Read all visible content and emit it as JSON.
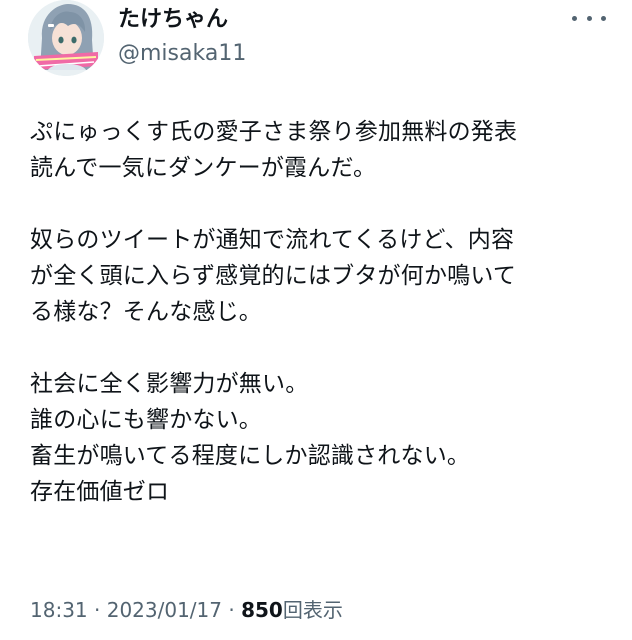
{
  "author": {
    "display_name": "たけちゃん",
    "handle": "@misaka11",
    "avatar_icon": "avatar-anime-character-icon"
  },
  "more_icon": "more-horizontal-icon",
  "tweet": {
    "lines": [
      "ぷにゅっくす氏の愛子さま祭り参加無料の発表",
      "読んで一気にダンケーが霞んだ。",
      "",
      "奴らのツイートが通知で流れてくるけど、内容",
      "が全く頭に入らず感覚的にはブタが何か鳴いて",
      "る様な？そんな感じ。",
      "",
      "社会に全く影響力が無い。",
      "誰の心にも響かない。",
      "畜生が鳴いてる程度にしか認識されない。",
      "存在価値ゼロ"
    ]
  },
  "meta": {
    "time": "18:31",
    "date": "2023/01/17",
    "separator": "·",
    "views_count": "850",
    "views_label": "回表示"
  },
  "colors": {
    "text_primary": "#0f1419",
    "text_secondary": "#536471",
    "background": "#ffffff"
  }
}
